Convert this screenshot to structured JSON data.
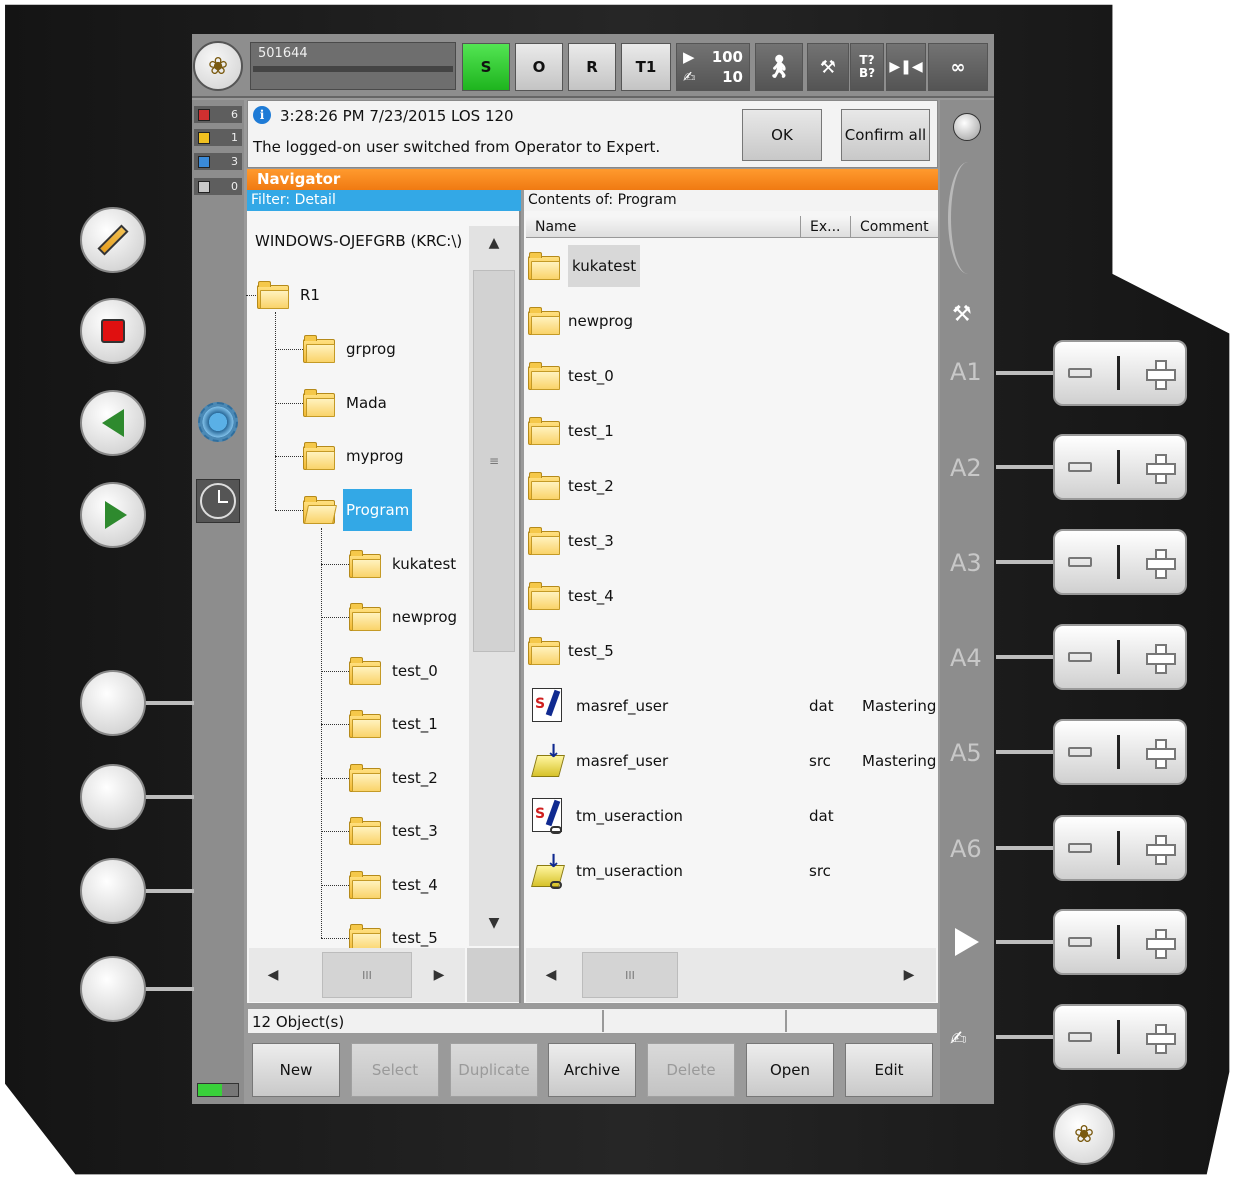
{
  "status_bar": {
    "robot_id": "501644",
    "submit_state": "S",
    "drive_state": "O",
    "interpreter": "R",
    "mode": "T1",
    "program_override": "100",
    "jog_override": "10",
    "tool_base": "T?",
    "base_label": "B?",
    "increment": "∞"
  },
  "message_counters": [
    {
      "type": "error",
      "count": "6",
      "color": "#d03030"
    },
    {
      "type": "warning",
      "count": "1",
      "color": "#f0c020"
    },
    {
      "type": "info",
      "count": "3",
      "color": "#3a8ad8"
    },
    {
      "type": "other",
      "count": "0",
      "color": "#c8c8c8"
    }
  ],
  "message": {
    "time": "3:28:26 PM 7/23/2015 LOS 120",
    "text": "The logged-on user switched from Operator to Expert.",
    "ok_label": "OK",
    "confirm_all_label": "Confirm all"
  },
  "navigator": {
    "title": "Navigator",
    "filter": "Filter: Detail",
    "contents_of": "Contents of: Program",
    "tree_root": "WINDOWS-OJEFGRB (KRC:\\)",
    "tree": [
      {
        "label": "R1",
        "level": 0
      },
      {
        "label": "grprog",
        "level": 1
      },
      {
        "label": "Mada",
        "level": 1
      },
      {
        "label": "myprog",
        "level": 1
      },
      {
        "label": "Program",
        "level": 1,
        "selected": true
      },
      {
        "label": "kukatest",
        "level": 2
      },
      {
        "label": "newprog",
        "level": 2
      },
      {
        "label": "test_0",
        "level": 2
      },
      {
        "label": "test_1",
        "level": 2
      },
      {
        "label": "test_2",
        "level": 2
      },
      {
        "label": "test_3",
        "level": 2
      },
      {
        "label": "test_4",
        "level": 2
      },
      {
        "label": "test_5",
        "level": 2
      }
    ],
    "columns": {
      "name": "Name",
      "ext": "Ex...",
      "comment": "Comment"
    },
    "files": [
      {
        "name": "kukatest",
        "kind": "folder",
        "ext": "",
        "comment": ""
      },
      {
        "name": "newprog",
        "kind": "folder",
        "ext": "",
        "comment": ""
      },
      {
        "name": "test_0",
        "kind": "folder",
        "ext": "",
        "comment": ""
      },
      {
        "name": "test_1",
        "kind": "folder",
        "ext": "",
        "comment": ""
      },
      {
        "name": "test_2",
        "kind": "folder",
        "ext": "",
        "comment": ""
      },
      {
        "name": "test_3",
        "kind": "folder",
        "ext": "",
        "comment": ""
      },
      {
        "name": "test_4",
        "kind": "folder",
        "ext": "",
        "comment": ""
      },
      {
        "name": "test_5",
        "kind": "folder",
        "ext": "",
        "comment": ""
      },
      {
        "name": "masref_user",
        "kind": "dat",
        "ext": "dat",
        "comment": "Mastering"
      },
      {
        "name": "masref_user",
        "kind": "src",
        "ext": "src",
        "comment": "Mastering"
      },
      {
        "name": "tm_useraction",
        "kind": "dat",
        "ext": "dat",
        "comment": ""
      },
      {
        "name": "tm_useraction",
        "kind": "src",
        "ext": "src",
        "comment": ""
      }
    ],
    "object_count": "12 Object(s)"
  },
  "buttons": {
    "new": "New",
    "select": "Select",
    "duplicate": "Duplicate",
    "archive": "Archive",
    "delete": "Delete",
    "open": "Open",
    "edit": "Edit"
  },
  "axes": [
    "A1",
    "A2",
    "A3",
    "A4",
    "A5",
    "A6"
  ],
  "colors": {
    "nav_header": "#f07a12",
    "selection": "#33a8e6",
    "submit_green": "#1eb41e"
  }
}
